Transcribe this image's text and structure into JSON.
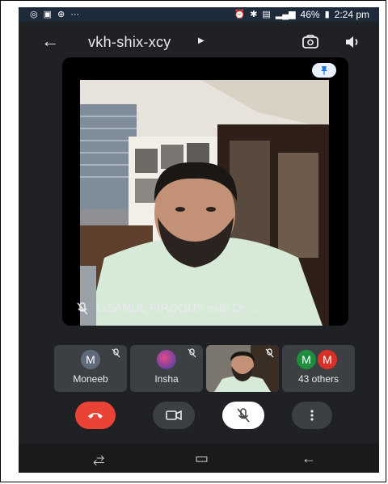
{
  "status_bar": {
    "battery": "46%",
    "time": "2:24 pm",
    "left_icons": [
      "whatsapp-icon",
      "gallery-icon",
      "grid-icon",
      "more-dots-icon"
    ]
  },
  "header": {
    "meeting_code": "vkh-shix-xcy"
  },
  "main_video": {
    "caption": "LISANUL FIRDOUS with Dr. ..."
  },
  "participants": [
    {
      "initial": "M",
      "name": "Moneeb",
      "avatar_color": "#5f6a7a",
      "muted": true
    },
    {
      "initial": "",
      "name": "Insha",
      "avatar_color": "#4a3a8a",
      "muted": true
    },
    {
      "initial": "",
      "name": "",
      "self_view": true
    },
    {
      "initials": [
        "M",
        "M"
      ],
      "name": "43 others",
      "avatar_colors": [
        "#1e8e3e",
        "#d93025"
      ]
    }
  ],
  "colors": {
    "end_call": "#ea4335",
    "control_dark": "#3c4043",
    "mic_button_bg": "#ffffff",
    "background": "#202124"
  }
}
